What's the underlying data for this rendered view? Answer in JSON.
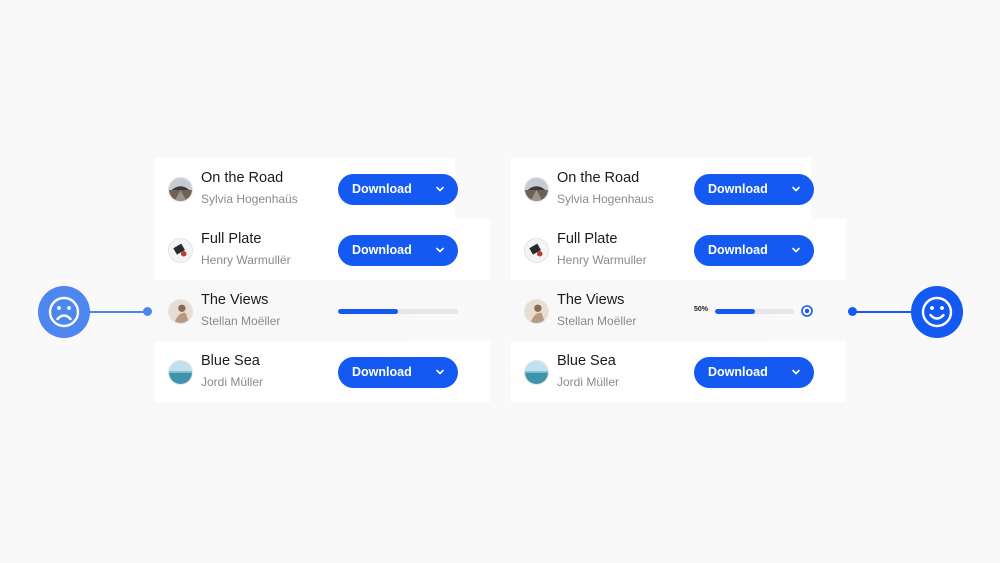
{
  "colors": {
    "accent": "#1459f2",
    "sad": "#4e86f0",
    "happy": "#1459f2",
    "track": "#e6e6ea",
    "background": "#f9f9fa"
  },
  "left_panel": {
    "rows": [
      {
        "title": "On the Road",
        "artist": "Sylvia Hogenhaüs",
        "button": "Download",
        "icon": "chevron-down-icon"
      },
      {
        "title": "Full Plate",
        "artist": "Henry Warmullër",
        "button": "Download",
        "icon": "chevron-down-icon"
      },
      {
        "title": "The Views",
        "artist": "Stellan Moëller",
        "progress": 0.5
      },
      {
        "title": "Blue Sea",
        "artist": "Jordi Müller",
        "button": "Download",
        "icon": "chevron-down-icon"
      }
    ]
  },
  "right_panel": {
    "rows": [
      {
        "title": "On the Road",
        "artist": "Sylvia Hogenhaus",
        "button": "Download",
        "icon": "chevron-down-icon"
      },
      {
        "title": "Full Plate",
        "artist": "Henry Warmuller",
        "button": "Download",
        "icon": "chevron-down-icon"
      },
      {
        "title": "The Views",
        "artist": "Stellan Moëller",
        "progress_label": "50%",
        "progress": 0.5,
        "cancel_icon": "close-icon"
      },
      {
        "title": "Blue Sea",
        "artist": "Jordi Müller",
        "button": "Download",
        "icon": "chevron-down-icon"
      }
    ]
  },
  "indicators": {
    "left": "sad-face-icon",
    "right": "happy-face-icon"
  }
}
